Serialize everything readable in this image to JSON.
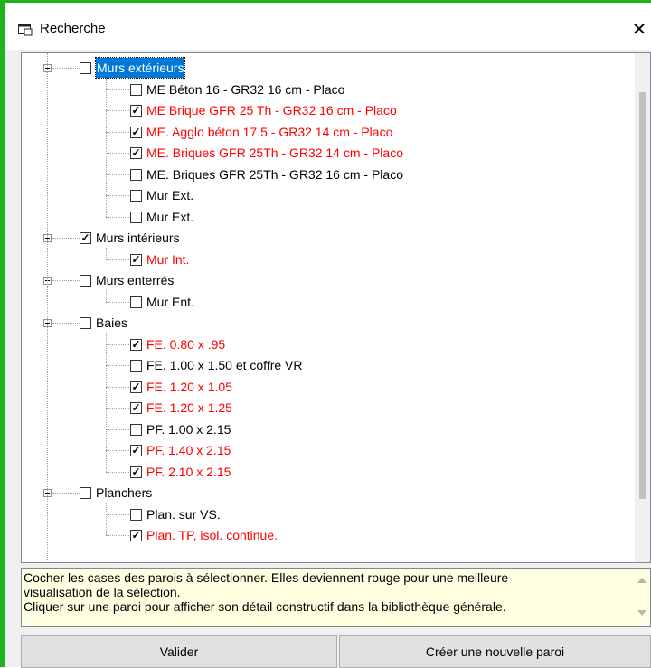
{
  "window": {
    "title": "Recherche",
    "close_glyph": "✕"
  },
  "tree": [
    {
      "label": "Murs extérieurs",
      "checked": false,
      "red": false,
      "level": 0,
      "selected": true
    },
    {
      "label": "ME Béton 16 - GR32 16 cm - Placo",
      "checked": false,
      "red": false,
      "level": 1
    },
    {
      "label": "ME Brique GFR 25 Th - GR32 16 cm - Placo",
      "checked": true,
      "red": true,
      "level": 1
    },
    {
      "label": "ME. Agglo béton 17.5 - GR32 14 cm - Placo",
      "checked": true,
      "red": true,
      "level": 1
    },
    {
      "label": "ME. Briques GFR 25Th - GR32 14 cm - Placo",
      "checked": true,
      "red": true,
      "level": 1
    },
    {
      "label": "ME. Briques GFR 25Th - GR32 16 cm - Placo",
      "checked": false,
      "red": false,
      "level": 1
    },
    {
      "label": "Mur Ext.",
      "checked": false,
      "red": false,
      "level": 1
    },
    {
      "label": "Mur Ext.",
      "checked": false,
      "red": false,
      "level": 1
    },
    {
      "label": "Murs intérieurs",
      "checked": true,
      "red": false,
      "level": 0
    },
    {
      "label": "Mur Int.",
      "checked": true,
      "red": true,
      "level": 1
    },
    {
      "label": "Murs enterrés",
      "checked": false,
      "red": false,
      "level": 0
    },
    {
      "label": "Mur Ent.",
      "checked": false,
      "red": false,
      "level": 1
    },
    {
      "label": "Baies",
      "checked": false,
      "red": false,
      "level": 0
    },
    {
      "label": "FE. 0.80 x .95",
      "checked": true,
      "red": true,
      "level": 1
    },
    {
      "label": "FE. 1.00 x 1.50 et coffre VR",
      "checked": false,
      "red": false,
      "level": 1
    },
    {
      "label": "FE. 1.20 x 1.05",
      "checked": true,
      "red": true,
      "level": 1
    },
    {
      "label": "FE. 1.20 x 1.25",
      "checked": true,
      "red": true,
      "level": 1
    },
    {
      "label": "PF. 1.00 x 2.15",
      "checked": false,
      "red": false,
      "level": 1
    },
    {
      "label": "PF. 1.40 x 2.15",
      "checked": true,
      "red": true,
      "level": 1
    },
    {
      "label": "PF. 2.10 x 2.15",
      "checked": true,
      "red": true,
      "level": 1
    },
    {
      "label": "Planchers",
      "checked": false,
      "red": false,
      "level": 0
    },
    {
      "label": "Plan. sur VS.",
      "checked": false,
      "red": false,
      "level": 1
    },
    {
      "label": "Plan. TP, isol. continue.",
      "checked": true,
      "red": true,
      "level": 1
    }
  ],
  "info": {
    "line1": "Cocher les cases des parois à sélectionner. Elles deviennent rouge pour une meilleure",
    "line2": "visualisation de la sélection.",
    "line3": "Cliquer sur une paroi pour afficher son détail constructif dans la bibliothèque générale."
  },
  "buttons": {
    "validate": "Valider",
    "create": "Créer une nouvelle paroi"
  },
  "colors": {
    "checked_item": "#ff0000",
    "selection": "#0078d7",
    "info_bg": "#ffffe1",
    "window_accent": "#1fb31f"
  }
}
